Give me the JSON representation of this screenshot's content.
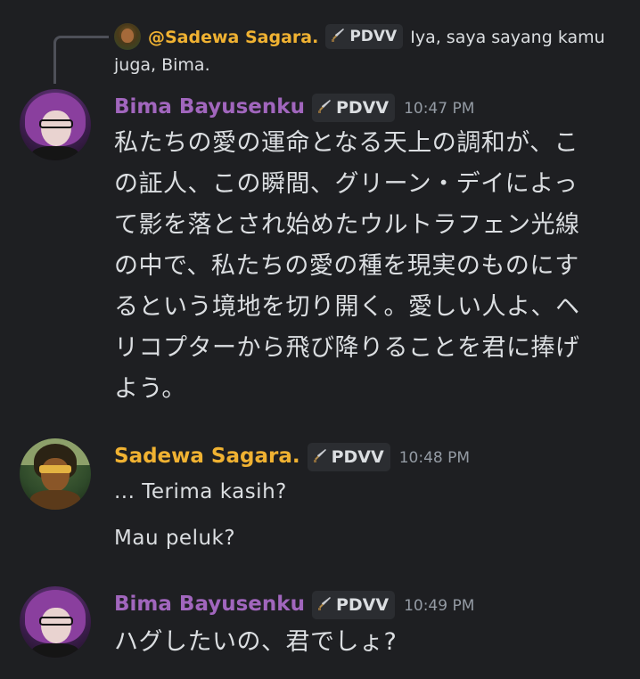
{
  "reply_preview": {
    "author": "@Sadewa Sagara.",
    "tag": "PDVV",
    "text_line1": "Iya, saya sayang kamu",
    "text_line2": "juga, Bima."
  },
  "messages": [
    {
      "author": "Bima Bayusenku",
      "tag": "PDVV",
      "timestamp": "10:47 PM",
      "lines": [
        "私たちの愛の運命となる天上の調和が、こ",
        "の証人、この瞬間、グリーン・デイによっ",
        "て影を落とされ始めたウルトラフェン光線",
        "の中で、私たちの愛の種を現実のものにす",
        "るという境地を切り開く。愛しい人よ、ヘ",
        "リコプターから飛び降りることを君に捧げ",
        "よう。"
      ]
    },
    {
      "author": "Sadewa Sagara.",
      "tag": "PDVV",
      "timestamp": "10:48 PM",
      "lines": [
        "... Terima kasih?",
        "Mau peluk?"
      ]
    },
    {
      "author": "Bima Bayusenku",
      "tag": "PDVV",
      "timestamp": "10:49 PM",
      "lines": [
        "ハグしたいの、君でしょ?"
      ]
    }
  ],
  "colors": {
    "background": "#1e1f22",
    "bima_name": "#a166bd",
    "sadewa_name": "#f0b232",
    "text": "#dbdee1",
    "timestamp": "#949ba4",
    "tag_bg": "#2b2d31"
  },
  "icons": {
    "tag_icon": "sword-icon"
  }
}
